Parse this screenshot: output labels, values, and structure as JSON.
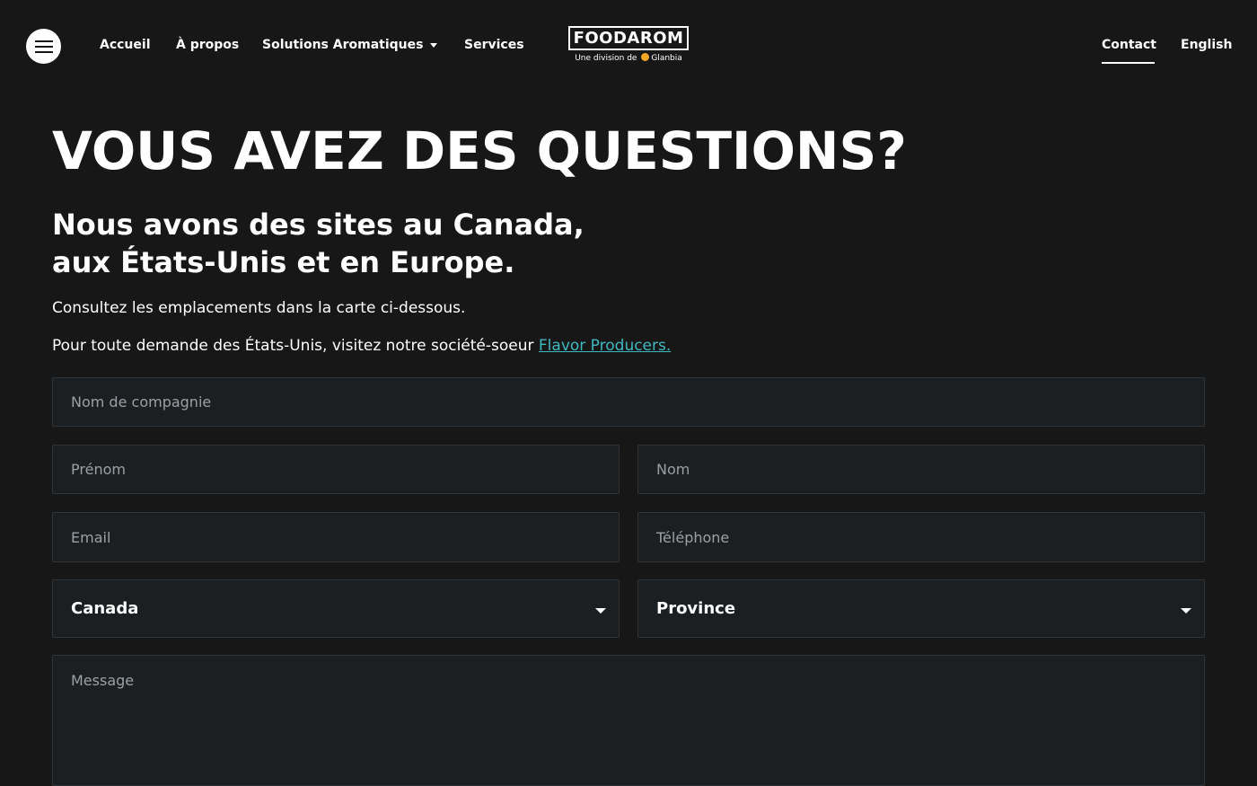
{
  "nav": {
    "menu_icon": "hamburger-icon",
    "links": [
      "Accueil",
      "À propos",
      "Solutions Aromatiques",
      "Services"
    ],
    "right_links": [
      "Contact",
      "English"
    ]
  },
  "logo": {
    "name": "FOODAROM",
    "tagline_prefix": "Une division de",
    "tagline_brand": "Glanbia"
  },
  "main": {
    "title": "VOUS AVEZ DES QUESTIONS?",
    "subtitle_line1": "Nous avons des sites au Canada,",
    "subtitle_line2": "aux États-Unis et en Europe.",
    "para1": "Consultez les emplacements dans la carte ci-dessous.",
    "para2_prefix": "Pour toute demande des États-Unis, visitez notre société-soeur ",
    "para2_link": "Flavor Producers."
  },
  "form": {
    "company_placeholder": "Nom de compagnie",
    "firstname_placeholder": "Prénom",
    "lastname_placeholder": "Nom",
    "email_placeholder": "Email",
    "phone_placeholder": "Téléphone",
    "country_value": "Canada",
    "province_value": "Province",
    "message_placeholder": "Message"
  },
  "colors": {
    "background": "#171717",
    "field_bg": "#1b1f22",
    "link": "#3fb8c0",
    "glanbia_dot": "#f5a623"
  }
}
